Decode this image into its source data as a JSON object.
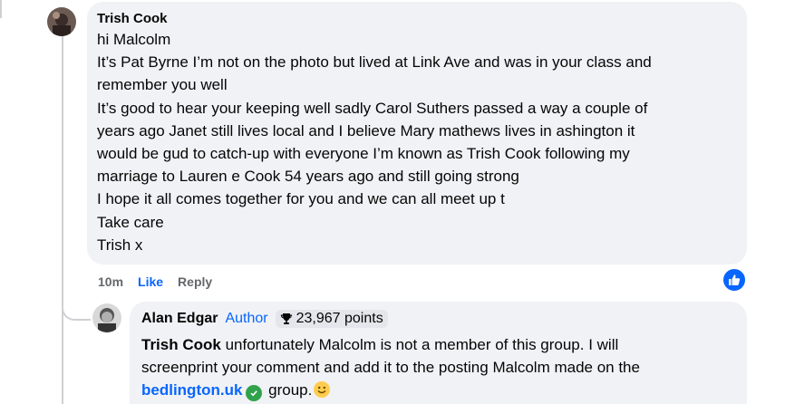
{
  "comment": {
    "author": "Trish Cook",
    "lines": [
      "hi Malcolm",
      "It’s Pat Byrne I’m not on the photo but lived at Link Ave and was in your class and",
      "remember you well",
      "It’s good to hear your keeping well sadly Carol Suthers passed a way a couple of",
      "years ago Janet still lives local and I believe Mary mathews lives in ashington it",
      "would be gud to catch-up with everyone I’m known as Trish Cook following my",
      "marriage to Lauren e Cook 54 years ago and still going strong",
      "I hope it all comes together for you and we can all meet up t",
      "Take care",
      "Trish x"
    ],
    "time": "10m",
    "like_label": "Like",
    "reply_label": "Reply",
    "reaction_icon": "like-icon",
    "reaction_color": "#0866ff"
  },
  "reply": {
    "author": "Alan Edgar",
    "author_tag": "Author",
    "points": "23,967 points",
    "points_icon": "trophy-icon",
    "mention": "Trish Cook",
    "line1_rest": " unfortunately Malcolm is not a member of this group. I will",
    "line2": "screenprint your comment and add it to the posting Malcolm made on the",
    "link": "bedlington.uk",
    "line3_rest": " group.",
    "verified_color": "#31a24c"
  }
}
